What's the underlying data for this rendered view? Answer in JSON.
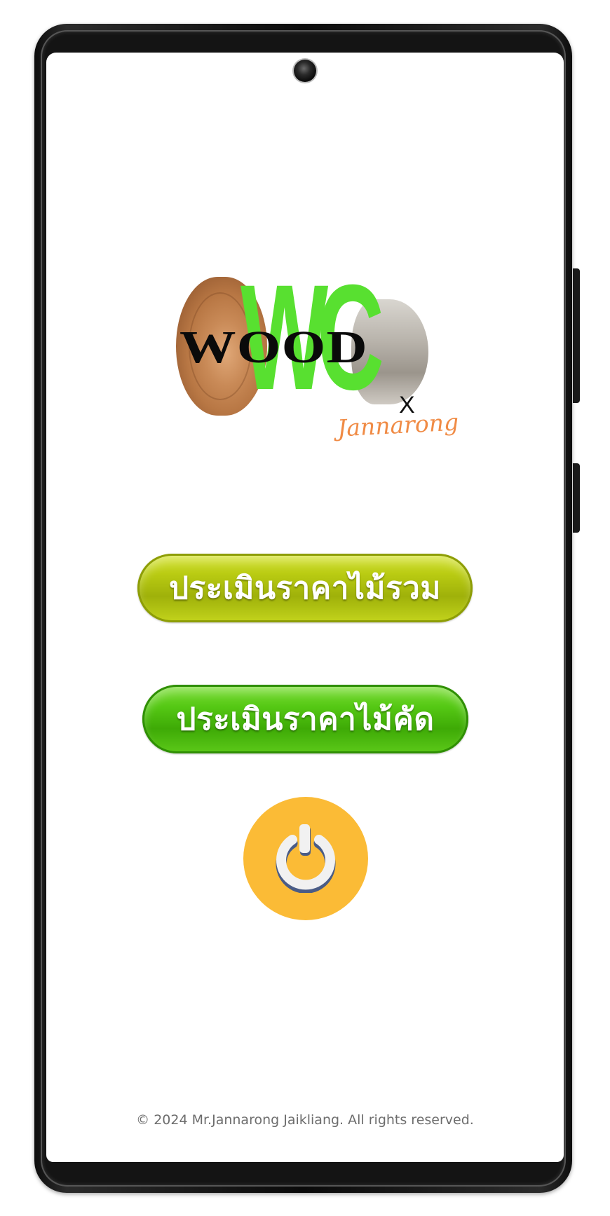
{
  "logo": {
    "wood": "WOOD",
    "wc": "WC",
    "x": "X",
    "signature": "Jannarong"
  },
  "buttons": {
    "total_price_label": "ประเมินราคาไม้รวม",
    "selected_price_label": "ประเมินราคาไม้คัด",
    "power_icon": "power-icon"
  },
  "footer": {
    "copyright": "© 2024 Mr.Jannarong Jaikliang. All rights reserved."
  },
  "colors": {
    "wc_green": "#58e030",
    "total_button": "#b9cb12",
    "selected_button": "#55c814",
    "power_button": "#fbbb36",
    "signature_orange": "#f08b45"
  }
}
